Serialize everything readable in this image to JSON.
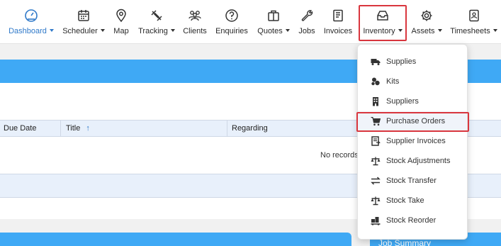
{
  "nav": {
    "items": [
      {
        "label": "Dashboard",
        "icon": "gauge-icon",
        "caret": true,
        "active": true
      },
      {
        "label": "Scheduler",
        "icon": "calendar-icon",
        "caret": true
      },
      {
        "label": "Map",
        "icon": "map-pin-icon",
        "caret": false
      },
      {
        "label": "Tracking",
        "icon": "satellite-icon",
        "caret": true
      },
      {
        "label": "Clients",
        "icon": "people-icon",
        "caret": false
      },
      {
        "label": "Enquiries",
        "icon": "question-icon",
        "caret": false
      },
      {
        "label": "Quotes",
        "icon": "briefcase-icon",
        "caret": true
      },
      {
        "label": "Jobs",
        "icon": "wrench-icon",
        "caret": false
      },
      {
        "label": "Invoices",
        "icon": "invoice-icon",
        "caret": false
      },
      {
        "label": "Inventory",
        "icon": "inbox-icon",
        "caret": true
      },
      {
        "label": "Assets",
        "icon": "gear-icon",
        "caret": true
      },
      {
        "label": "Timesheets",
        "icon": "timesheet-icon",
        "caret": true
      }
    ]
  },
  "table": {
    "headers": [
      "Due Date",
      "Title",
      "Regarding"
    ],
    "sort_icon": "arrow-up-icon",
    "empty_text": "No records"
  },
  "summary": {
    "title": "Job Summary"
  },
  "inventory_menu": {
    "items": [
      {
        "label": "Supplies",
        "icon": "truck-icon"
      },
      {
        "label": "Kits",
        "icon": "kits-icon"
      },
      {
        "label": "Suppliers",
        "icon": "building-icon"
      },
      {
        "label": "Purchase Orders",
        "icon": "cart-icon",
        "selected": true
      },
      {
        "label": "Supplier Invoices",
        "icon": "invoice-icon"
      },
      {
        "label": "Stock Adjustments",
        "icon": "scale-icon"
      },
      {
        "label": "Stock Transfer",
        "icon": "transfer-icon"
      },
      {
        "label": "Stock Take",
        "icon": "scale-icon"
      },
      {
        "label": "Stock Reorder",
        "icon": "reorder-icon"
      }
    ]
  },
  "colors": {
    "accent": "#3fa9f5",
    "active_text": "#2f79c9",
    "highlight": "#d9363e"
  }
}
